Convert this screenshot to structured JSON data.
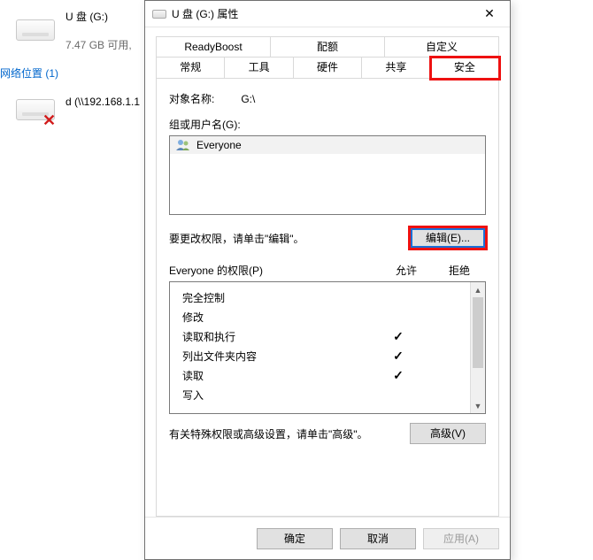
{
  "background": {
    "drive_label": "U 盘 (G:)",
    "drive_free": "7.47 GB 可用,",
    "net_header": "网络位置 (1)",
    "net_item": "d (\\\\192.168.1.1"
  },
  "dialog": {
    "title": "U 盘 (G:) 属性",
    "close_glyph": "✕",
    "tabs_row1": [
      "ReadyBoost",
      "配额",
      "自定义"
    ],
    "tabs_row2": [
      "常规",
      "工具",
      "硬件",
      "共享",
      "安全"
    ],
    "active_tab": "安全",
    "object_label": "对象名称:",
    "object_value": "G:\\",
    "groups_label": "组或用户名(G):",
    "groups": [
      {
        "name": "Everyone",
        "selected": true
      }
    ],
    "edit_hint": "要更改权限，请单击\"编辑\"。",
    "edit_button": "编辑(E)...",
    "perm_header_label": "Everyone 的权限(P)",
    "perm_allow": "允许",
    "perm_deny": "拒绝",
    "permissions": [
      {
        "name": "完全控制",
        "allow": false,
        "deny": false
      },
      {
        "name": "修改",
        "allow": false,
        "deny": false
      },
      {
        "name": "读取和执行",
        "allow": true,
        "deny": false
      },
      {
        "name": "列出文件夹内容",
        "allow": true,
        "deny": false
      },
      {
        "name": "读取",
        "allow": true,
        "deny": false
      },
      {
        "name": "写入",
        "allow": false,
        "deny": false
      }
    ],
    "advanced_hint": "有关特殊权限或高级设置，请单击\"高级\"。",
    "advanced_button": "高级(V)",
    "ok": "确定",
    "cancel": "取消",
    "apply": "应用(A)"
  }
}
